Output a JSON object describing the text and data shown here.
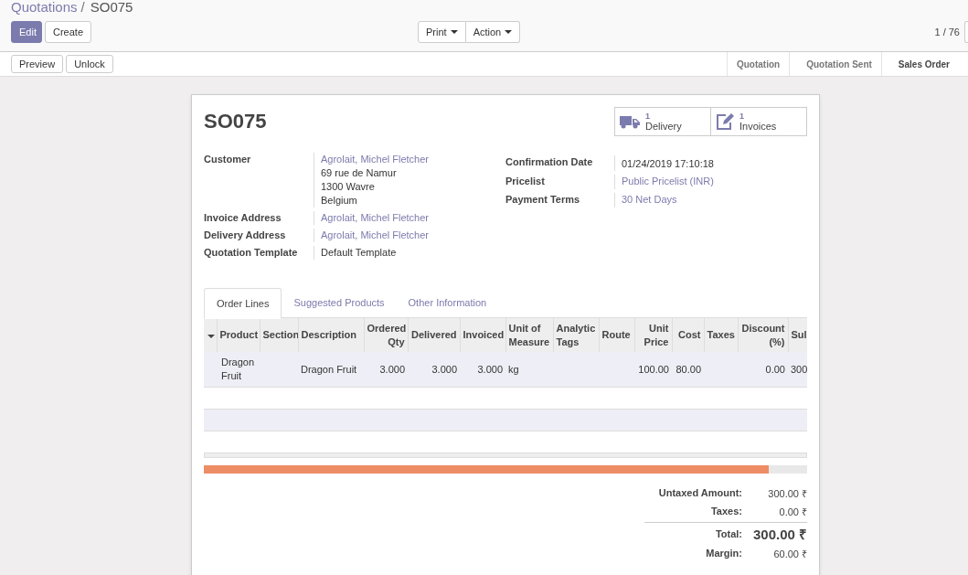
{
  "breadcrumb": {
    "parent": "Quotations",
    "separator": "/",
    "current": "SO075"
  },
  "buttons": [
    "Edit",
    "Create"
  ],
  "dropdowns": [
    "Print",
    "Action"
  ],
  "pager": "1 / 76",
  "status_buttons": [
    "Preview",
    "Unlock"
  ],
  "stages": [
    {
      "label": "Quotation",
      "selected": false
    },
    {
      "label": "Quotation Sent",
      "selected": false
    },
    {
      "label": "Sales Order",
      "selected": true
    }
  ],
  "title": "SO075",
  "smart_buttons": [
    {
      "kind": "truck",
      "count": "1",
      "label": "Delivery"
    },
    {
      "kind": "edit",
      "count": "1",
      "label": "Invoices"
    }
  ],
  "left_fields": [
    {
      "label": "Customer",
      "kind": "link",
      "lines": [
        "Agrolait, Michel Fletcher",
        "69 rue de Namur",
        "1300 Wavre",
        "Belgium"
      ]
    },
    {
      "label": "Invoice Address",
      "kind": "link",
      "lines": [
        "Agrolait, Michel Fletcher"
      ]
    },
    {
      "label": "Delivery Address",
      "kind": "link",
      "lines": [
        "Agrolait, Michel Fletcher"
      ]
    },
    {
      "label": "Quotation Template",
      "kind": "text",
      "lines": [
        "Default Template"
      ]
    }
  ],
  "right_fields": [
    {
      "label": "Confirmation Date",
      "kind": "text",
      "lines": [
        "01/24/2019 17:10:18"
      ]
    },
    {
      "label": "Pricelist",
      "kind": "link",
      "lines": [
        "Public Pricelist (INR)"
      ]
    },
    {
      "label": "Payment Terms",
      "kind": "link",
      "lines": [
        "30 Net Days"
      ]
    }
  ],
  "tabs": [
    {
      "label": "Order Lines",
      "selected": true
    },
    {
      "label": "Suggested Products",
      "selected": false
    },
    {
      "label": "Other Information",
      "selected": false
    }
  ],
  "table": {
    "columns": [
      "Product",
      "Section",
      "Description",
      "Ordered Qty",
      "Delivered",
      "Invoiced",
      "Unit of Measure",
      "Analytic Tags",
      "Route",
      "Unit Price",
      "Cost",
      "Taxes",
      "Discount (%)",
      "Sul"
    ],
    "rows": [
      [
        "Dragon Fruit",
        "",
        "Dragon Fruit",
        "3.000",
        "3.000",
        "3.000",
        "kg",
        "",
        "",
        "100.00",
        "80.00",
        "",
        "0.00",
        "300"
      ]
    ]
  },
  "totals": [
    {
      "label": "Untaxed Amount:",
      "value": "300.00 ₹",
      "kind": "normal"
    },
    {
      "label": "Taxes:",
      "value": "0.00 ₹",
      "kind": "normal"
    },
    {
      "label": "Total:",
      "value": "300.00 ₹",
      "kind": "total"
    },
    {
      "label": "Margin:",
      "value": "60.00 ₹",
      "kind": "normal"
    }
  ]
}
